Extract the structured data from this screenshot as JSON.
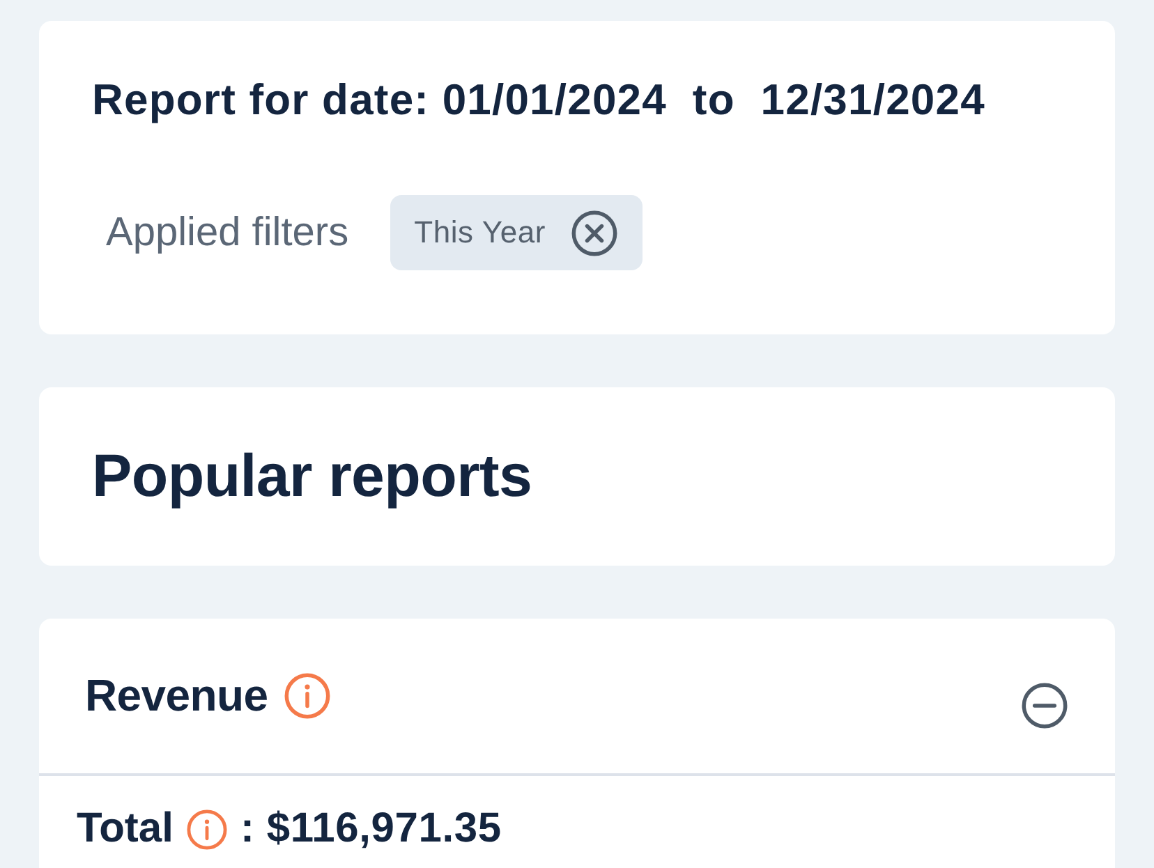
{
  "report_header": {
    "title": "Report for date: 01/01/2024  to  12/31/2024",
    "filters_label": "Applied filters",
    "filters": [
      {
        "label": "This Year"
      }
    ]
  },
  "popular_reports": {
    "title": "Popular reports"
  },
  "reports": [
    {
      "title": "Revenue",
      "expanded": true,
      "total_label": "Total",
      "total_value": ": $116,971.35"
    }
  ]
}
